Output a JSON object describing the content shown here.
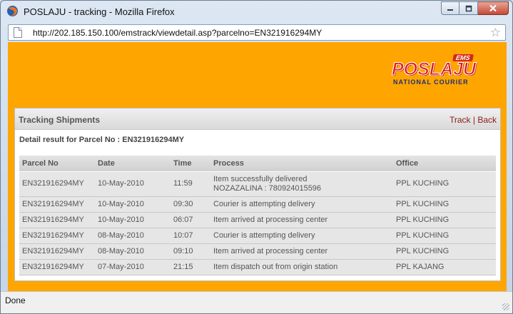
{
  "window": {
    "title": "POSLAJU - tracking - Mozilla Firefox"
  },
  "addressbar": {
    "url": "http://202.185.150.100/emstrack/viewdetail.asp?parcelno=EN321916294MY"
  },
  "logo": {
    "ems": "EMS",
    "main": "POSLAJU",
    "sub": "NATIONAL COURIER"
  },
  "panel": {
    "title": "Tracking Shipments",
    "link_track": "Track",
    "separator": " | ",
    "link_back": "Back",
    "detail": "Detail result for Parcel No : EN321916294MY"
  },
  "table": {
    "headers": [
      "Parcel No",
      "Date",
      "Time",
      "Process",
      "Office"
    ],
    "rows": [
      {
        "parcel": "EN321916294MY",
        "date": "10-May-2010",
        "time": "11:59",
        "process": "Item successfully delivered",
        "process2": "NOZAZALINA : 780924015596",
        "office": "PPL KUCHING"
      },
      {
        "parcel": "EN321916294MY",
        "date": "10-May-2010",
        "time": "09:30",
        "process": "Courier is attempting delivery",
        "office": "PPL KUCHING"
      },
      {
        "parcel": "EN321916294MY",
        "date": "10-May-2010",
        "time": "06:07",
        "process": "Item arrived at processing center",
        "office": "PPL KUCHING"
      },
      {
        "parcel": "EN321916294MY",
        "date": "08-May-2010",
        "time": "10:07",
        "process": "Courier is attempting delivery",
        "office": "PPL KUCHING"
      },
      {
        "parcel": "EN321916294MY",
        "date": "08-May-2010",
        "time": "09:10",
        "process": "Item arrived at processing center",
        "office": "PPL KUCHING"
      },
      {
        "parcel": "EN321916294MY",
        "date": "07-May-2010",
        "time": "21:15",
        "process": "Item dispatch out from origin station",
        "office": "PPL KAJANG"
      }
    ]
  },
  "statusbar": {
    "text": "Done"
  },
  "colors": {
    "page_background": "#ffa500",
    "link": "#8b1a1a",
    "brand_red": "#e31c18",
    "brand_navy": "#1f2f73"
  },
  "icons": {
    "app": "firefox-icon",
    "page": "page-icon",
    "bookmark": "star-icon"
  }
}
